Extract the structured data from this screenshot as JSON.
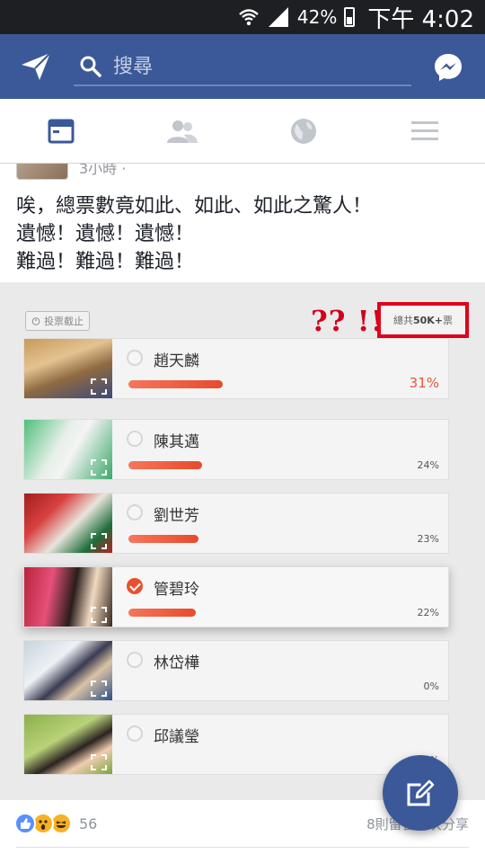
{
  "status_bar": {
    "battery": "42%",
    "time": "下午 4:02"
  },
  "header": {
    "search_placeholder": "搜尋",
    "brand_color": "#3b5998"
  },
  "tabs": [
    {
      "name": "news-feed",
      "icon": "news-feed-icon",
      "active": true
    },
    {
      "name": "friends",
      "icon": "friends-icon",
      "active": false
    },
    {
      "name": "notifications",
      "icon": "globe-icon",
      "active": false
    },
    {
      "name": "menu",
      "icon": "menu-icon",
      "active": false
    }
  ],
  "post": {
    "meta": "3小時 · ",
    "lines": [
      "唉，總票數竟如此、如此、如此之驚人！",
      "遺憾！遺憾！遺憾！",
      "難過！難過！難過！"
    ]
  },
  "poll": {
    "closed_label": "投票截止",
    "annotation": "?? !!",
    "total_prefix": "總共",
    "total_value": "50K+",
    "total_suffix": "票",
    "options": [
      {
        "name": "趙天麟",
        "percent": 31,
        "percent_label": "31%",
        "selected": false
      },
      {
        "name": "陳其邁",
        "percent": 24,
        "percent_label": "24%",
        "selected": false
      },
      {
        "name": "劉世芳",
        "percent": 23,
        "percent_label": "23%",
        "selected": false
      },
      {
        "name": "管碧玲",
        "percent": 22,
        "percent_label": "22%",
        "selected": true
      },
      {
        "name": "林岱樺",
        "percent": 0,
        "percent_label": "0%",
        "selected": false
      },
      {
        "name": "邱議瑩",
        "percent": 0,
        "percent_label": "0%",
        "selected": false
      }
    ]
  },
  "footer": {
    "reaction_count": "56",
    "comments": "8則留言",
    "shares": "3次分享"
  }
}
